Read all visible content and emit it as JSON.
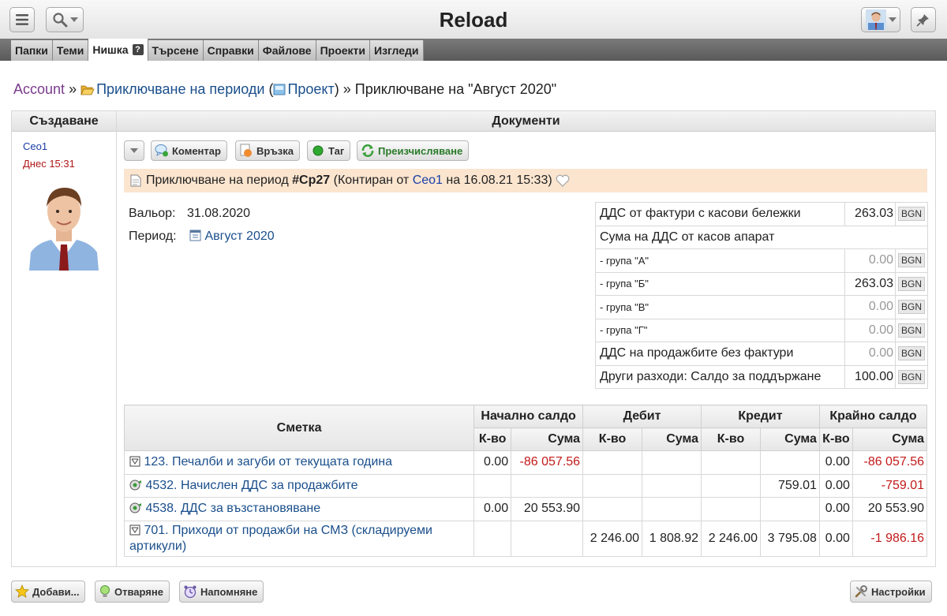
{
  "header": {
    "title": "Reload"
  },
  "nav": {
    "tabs": [
      {
        "label": "Папки"
      },
      {
        "label": "Теми"
      },
      {
        "label": "Нишка",
        "badge": "?"
      },
      {
        "label": "Търсене"
      },
      {
        "label": "Справки"
      },
      {
        "label": "Файлове"
      },
      {
        "label": "Проекти"
      },
      {
        "label": "Изгледи"
      }
    ],
    "active": "Нишка"
  },
  "breadcrumb": {
    "root": "Account",
    "sep1": "»",
    "folder": "Приключване на периоди",
    "project_open": "(",
    "project": "Проект",
    "project_close": ")",
    "sep2": "»",
    "current": "Приключване на \"Август 2020\""
  },
  "columns": {
    "left": "Създаване",
    "right": "Документи"
  },
  "creator": {
    "name": "Ceo1",
    "time": "Днес 15:31"
  },
  "actions": {
    "comment": "Коментар",
    "link": "Връзка",
    "tag": "Таг",
    "recalc": "Преизчисляване"
  },
  "document": {
    "title_prefix": "Приключване на период",
    "number": "#Cp27",
    "posted_prefix": "(Контиран от",
    "posted_by": "Ceo1",
    "posted_on": "на 16.08.21 15:33)"
  },
  "fields": {
    "valor_label": "Вальор:",
    "valor_value": "31.08.2020",
    "period_label": "Период:",
    "period_value": "Август 2020"
  },
  "vat": {
    "currency": "BGN",
    "rows": [
      {
        "label": "ДДС от фактури с касови бележки",
        "value": "263.03"
      },
      {
        "label": "Сума на ДДС от касов апарат",
        "value": ""
      },
      {
        "label": "- група \"А\"",
        "value": "0.00"
      },
      {
        "label": "- група \"Б\"",
        "value": "263.03"
      },
      {
        "label": "- група \"В\"",
        "value": "0.00"
      },
      {
        "label": "- група \"Г\"",
        "value": "0.00"
      },
      {
        "label": "ДДС на продажбите без фактури",
        "value": "0.00"
      },
      {
        "label": "Други разходи: Салдо за поддържане",
        "value": "100.00"
      }
    ]
  },
  "accounts": {
    "headers": {
      "account": "Сметка",
      "opening": "Начално салдо",
      "debit": "Дебит",
      "credit": "Кредит",
      "closing": "Крайно салдо",
      "qty": "К-во",
      "amount": "Сума"
    },
    "rows": [
      {
        "account": "123. Печалби и загуби от текущата година",
        "open_qty": "0.00",
        "open_amt": "-86 057.56",
        "deb_qty": "",
        "deb_amt": "",
        "cred_qty": "",
        "cred_amt": "",
        "close_qty": "0.00",
        "close_amt": "-86 057.56"
      },
      {
        "account": "4532. Начислен ДДС за продажбите",
        "open_qty": "",
        "open_amt": "",
        "deb_qty": "",
        "deb_amt": "",
        "cred_qty": "",
        "cred_amt": "759.01",
        "close_qty": "0.00",
        "close_amt": "-759.01"
      },
      {
        "account": "4538. ДДС за възстановяване",
        "open_qty": "0.00",
        "open_amt": "20 553.90",
        "deb_qty": "",
        "deb_amt": "",
        "cred_qty": "",
        "cred_amt": "",
        "close_qty": "0.00",
        "close_amt": "20 553.90"
      },
      {
        "account": "701. Приходи от продажби на СМЗ (складируеми артикули)",
        "open_qty": "",
        "open_amt": "",
        "deb_qty": "2 246.00",
        "deb_amt": "1 808.92",
        "cred_qty": "2 246.00",
        "cred_amt": "3 795.08",
        "close_qty": "0.00",
        "close_amt": "-1 986.16"
      }
    ]
  },
  "footer": {
    "add": "Добави...",
    "open": "Отваряне",
    "remind": "Напомняне",
    "settings": "Настройки"
  },
  "colors": {
    "negative": "#c21a1a",
    "link": "#1a4f8c",
    "banner": "#fbe5cf"
  }
}
